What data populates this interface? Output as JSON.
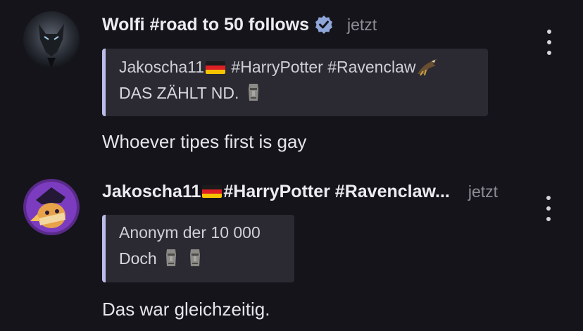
{
  "messages": [
    {
      "author": "Wolfi #road to 50 follows",
      "verified": true,
      "time": "jetzt",
      "quote": {
        "author": "Jakoscha11",
        "author_suffix": " #HarryPotter #Ravenclaw",
        "text": "DAS ZÄHLT ND."
      },
      "text": "Whoever tipes first is gay"
    },
    {
      "author": "Jakoscha11",
      "author_suffix": " #HarryPotter #Ravenclaw...",
      "time": "jetzt",
      "quote": {
        "author": "Anonym der 10 000",
        "text": "Doch"
      },
      "text": "Das war gleichzeitig."
    }
  ],
  "icons": {
    "verified": "verified-badge-icon",
    "flag": "germany-flag-icon",
    "moai": "moai-emoji-icon",
    "eagle": "eagle-emoji-icon",
    "more": "more-vertical-icon"
  },
  "colors": {
    "background": "#15141b",
    "quote_bg": "#2b2a32",
    "quote_bar": "#bcbce8",
    "verified": "#8fa6d9"
  }
}
